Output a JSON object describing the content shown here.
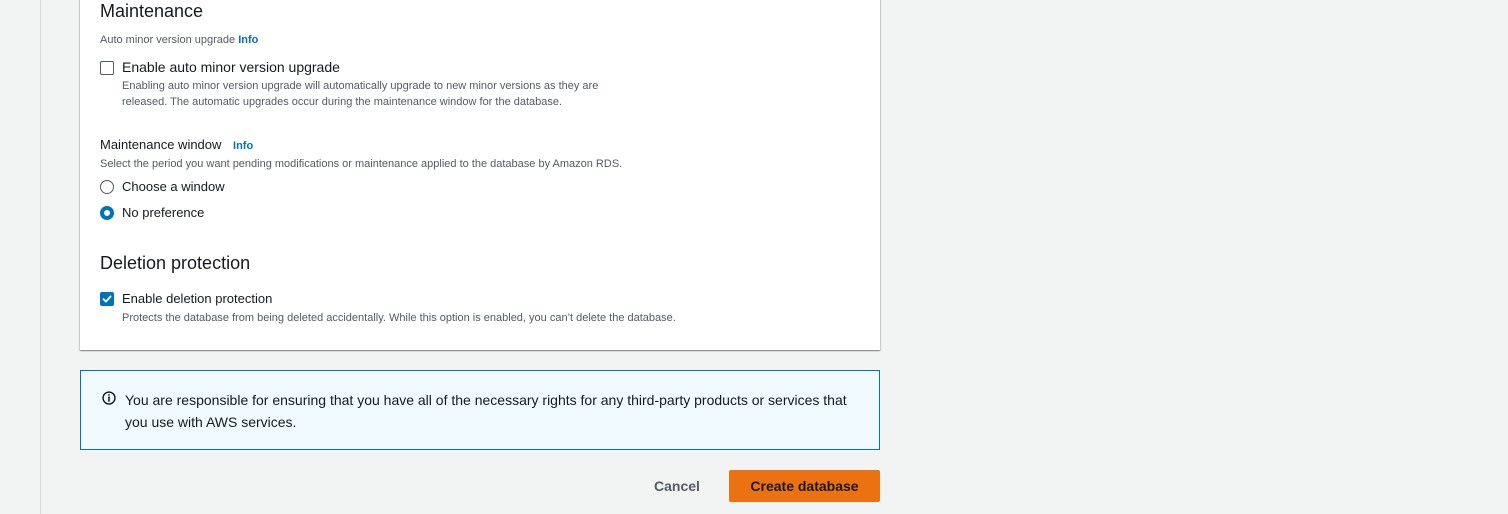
{
  "maintenance": {
    "title": "Maintenance",
    "auto_minor_label": "Auto minor version upgrade",
    "info_link": "Info",
    "auto_minor_checkbox": {
      "label": "Enable auto minor version upgrade",
      "checked": false,
      "description_line1": "Enabling auto minor version upgrade will automatically upgrade to new minor versions as they are",
      "description_line2": "released. The automatic upgrades occur during the maintenance window for the database."
    },
    "window": {
      "label": "Maintenance window",
      "info_link": "Info",
      "description": "Select the period you want pending modifications or maintenance applied to the database by Amazon RDS.",
      "options": [
        {
          "label": "Choose a window",
          "selected": false
        },
        {
          "label": "No preference",
          "selected": true
        }
      ]
    }
  },
  "deletion_protection": {
    "title": "Deletion protection",
    "checkbox": {
      "label": "Enable deletion protection",
      "checked": true,
      "description": "Protects the database from being deleted accidentally. While this option is enabled, you can’t delete the database."
    }
  },
  "alert": {
    "icon": "info-circle-icon",
    "text": "You are responsible for ensuring that you have all of the necessary rights for any third-party products or services that you use with AWS services."
  },
  "actions": {
    "cancel_label": "Cancel",
    "create_label": "Create database"
  },
  "colors": {
    "accent": "#0073bb",
    "primary_button": "#ec7211",
    "background": "#f2f3f3",
    "alert_background": "#f1faff"
  }
}
